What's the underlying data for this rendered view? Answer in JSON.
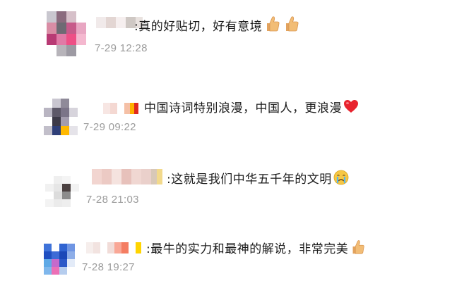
{
  "comments": [
    {
      "text": ":真的好贴切，好有意境",
      "emojis": [
        "thumbs-up-icon",
        "thumbs-up-icon"
      ],
      "time": "7-29 12:28"
    },
    {
      "text": "中国诗词特别浪漫，中国人，更浪漫",
      "emojis": [
        "red-heart-icon"
      ],
      "time": "7-29 09:22"
    },
    {
      "text": ":这就是我们中华五千年的文明",
      "emojis": [
        "crying-face-icon"
      ],
      "time": "7-28 21:03"
    },
    {
      "text": ":最牛的实力和最神的解说，非常完美",
      "emojis": [
        "thumbs-up-icon"
      ],
      "time": "7-28 19:27"
    }
  ],
  "colors": {
    "text": "#1a1a1a",
    "time": "#9b9b9b",
    "heart": "#e8232e",
    "thumb": "#f2bd76"
  }
}
